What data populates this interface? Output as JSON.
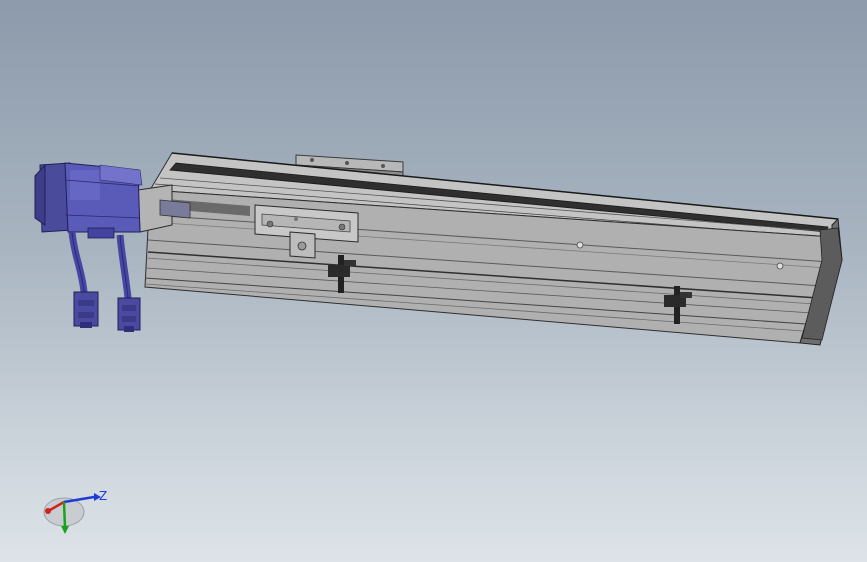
{
  "viewport": {
    "background_top": "#8c9aab",
    "background_bottom": "#dde3e8"
  },
  "model": {
    "body_color": "#9a9a9a",
    "motor_color": "#5a5ab8",
    "connector_color": "#4a4aa0"
  },
  "triad": {
    "z_label": "Z",
    "z_color": "#1f3bd6",
    "x_color": "#d32020",
    "y_color": "#19a319"
  }
}
